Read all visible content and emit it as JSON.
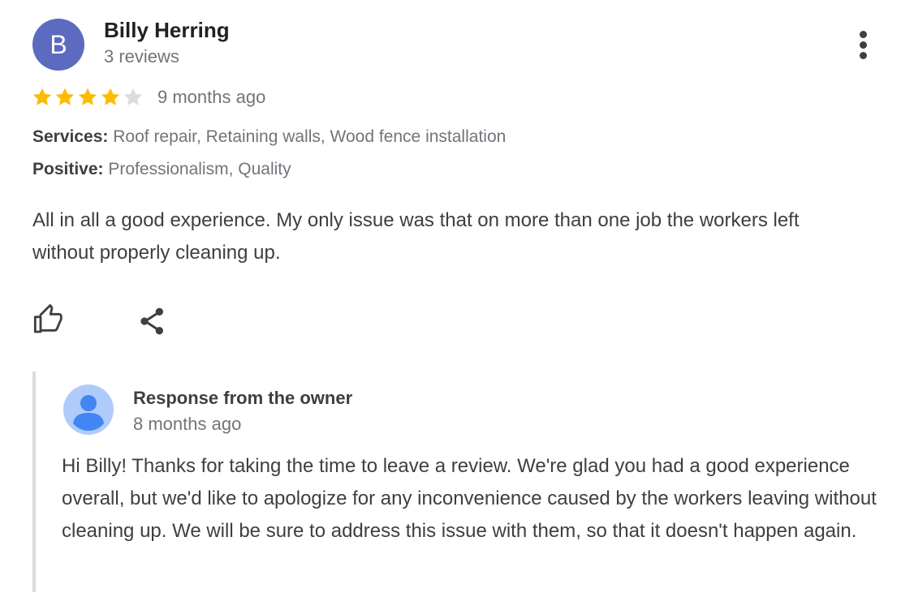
{
  "review": {
    "avatar_initial": "B",
    "reviewer_name": "Billy Herring",
    "review_count": "3 reviews",
    "rating": 4,
    "rating_max": 5,
    "time_ago": "9 months ago",
    "details": [
      {
        "label": "Services:",
        "value": "Roof repair, Retaining walls, Wood fence installation"
      },
      {
        "label": "Positive:",
        "value": "Professionalism, Quality"
      }
    ],
    "text": "All in all a good experience. My only issue was that on more than one job the workers left without properly cleaning up.",
    "actions": {
      "like_icon": "thumbs-up-icon",
      "share_icon": "share-icon",
      "more_icon": "more-vert-icon"
    }
  },
  "owner_response": {
    "label": "Response from the owner",
    "time_ago": "8 months ago",
    "text": "Hi Billy! Thanks for taking the time to leave a review. We're glad you had a good experience overall, but we'd like to apologize for any inconvenience caused by the workers leaving without cleaning up. We will be sure to address this issue with them, so that it doesn't happen again."
  },
  "colors": {
    "avatar_bg": "#5c6bc0",
    "star_filled": "#fbbc04",
    "star_empty": "#dadce0",
    "text_primary": "#202124",
    "text_secondary": "#70757a",
    "response_border": "#dadce0",
    "owner_avatar_bg": "#aecbfa",
    "owner_avatar_fg": "#4285f4"
  }
}
